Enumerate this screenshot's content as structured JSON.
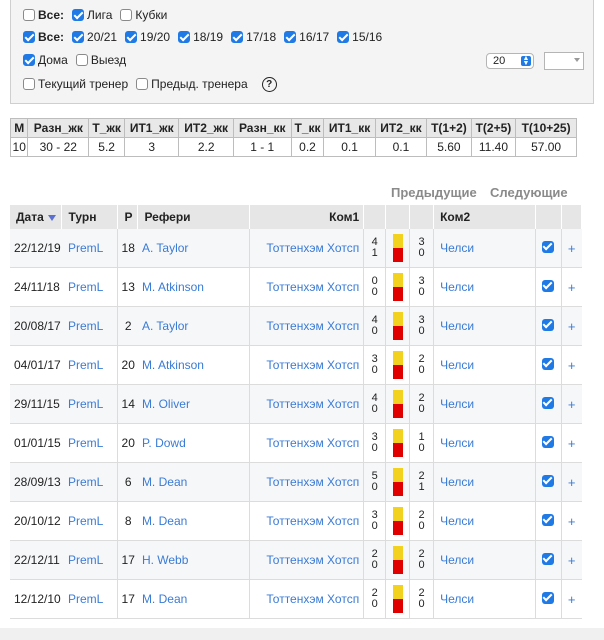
{
  "filters": {
    "row1": [
      {
        "label": "Все:",
        "checked": false,
        "bold": true
      },
      {
        "label": "Лига",
        "checked": true,
        "bold": false
      },
      {
        "label": "Кубки",
        "checked": false,
        "bold": false
      }
    ],
    "row2": [
      {
        "label": "Все:",
        "checked": true,
        "bold": true
      },
      {
        "label": "20/21",
        "checked": true,
        "bold": false
      },
      {
        "label": "19/20",
        "checked": true,
        "bold": false
      },
      {
        "label": "18/19",
        "checked": true,
        "bold": false
      },
      {
        "label": "17/18",
        "checked": true,
        "bold": false
      },
      {
        "label": "16/17",
        "checked": true,
        "bold": false
      },
      {
        "label": "15/16",
        "checked": true,
        "bold": false
      }
    ],
    "row3": [
      {
        "label": "Дома",
        "checked": true,
        "bold": false
      },
      {
        "label": "Выезд",
        "checked": false,
        "bold": false
      }
    ],
    "row4": [
      {
        "label": "Текущий тренер",
        "checked": false,
        "bold": false
      },
      {
        "label": "Предыд. тренера",
        "checked": false,
        "bold": false
      }
    ],
    "help": "?",
    "count_select": "20",
    "spin_value": ""
  },
  "stats": {
    "headers": [
      "М",
      "Разн_жк",
      "Т_жк",
      "ИТ1_жк",
      "ИТ2_жк",
      "Разн_кк",
      "Т_кк",
      "ИТ1_кк",
      "ИТ2_кк",
      "Т(1+2)",
      "Т(2+5)",
      "Т(10+25)"
    ],
    "values": [
      "10",
      "30 - 22",
      "5.2",
      "3",
      "2.2",
      "1 - 1",
      "0.2",
      "0.1",
      "0.1",
      "5.60",
      "11.40",
      "57.00"
    ]
  },
  "nav": {
    "prev": "Предыдущие",
    "next": "Следующие"
  },
  "matches": {
    "headers": {
      "date": "Дата",
      "tour": "Турн",
      "round": "Р",
      "ref": "Рефери",
      "team1": "Ком1",
      "team2": "Ком2"
    },
    "rows": [
      {
        "date": "22/12/19",
        "tour": "PremL",
        "r": "18",
        "ref": "A. Taylor",
        "t1": "Тоттенхэм Хотсп",
        "s1a": "4",
        "s1b": "1",
        "s2a": "3",
        "s2b": "0",
        "t2": "Челси"
      },
      {
        "date": "24/11/18",
        "tour": "PremL",
        "r": "13",
        "ref": "M. Atkinson",
        "t1": "Тоттенхэм Хотсп",
        "s1a": "0",
        "s1b": "0",
        "s2a": "3",
        "s2b": "0",
        "t2": "Челси"
      },
      {
        "date": "20/08/17",
        "tour": "PremL",
        "r": "2",
        "ref": "A. Taylor",
        "t1": "Тоттенхэм Хотсп",
        "s1a": "4",
        "s1b": "0",
        "s2a": "3",
        "s2b": "0",
        "t2": "Челси"
      },
      {
        "date": "04/01/17",
        "tour": "PremL",
        "r": "20",
        "ref": "M. Atkinson",
        "t1": "Тоттенхэм Хотсп",
        "s1a": "3",
        "s1b": "0",
        "s2a": "2",
        "s2b": "0",
        "t2": "Челси"
      },
      {
        "date": "29/11/15",
        "tour": "PremL",
        "r": "14",
        "ref": "M. Oliver",
        "t1": "Тоттенхэм Хотсп",
        "s1a": "4",
        "s1b": "0",
        "s2a": "2",
        "s2b": "0",
        "t2": "Челси"
      },
      {
        "date": "01/01/15",
        "tour": "PremL",
        "r": "20",
        "ref": "P. Dowd",
        "t1": "Тоттенхэм Хотсп",
        "s1a": "3",
        "s1b": "0",
        "s2a": "1",
        "s2b": "0",
        "t2": "Челси"
      },
      {
        "date": "28/09/13",
        "tour": "PremL",
        "r": "6",
        "ref": "M. Dean",
        "t1": "Тоттенхэм Хотсп",
        "s1a": "5",
        "s1b": "0",
        "s2a": "2",
        "s2b": "1",
        "t2": "Челси"
      },
      {
        "date": "20/10/12",
        "tour": "PremL",
        "r": "8",
        "ref": "M. Dean",
        "t1": "Тоттенхэм Хотсп",
        "s1a": "3",
        "s1b": "0",
        "s2a": "2",
        "s2b": "0",
        "t2": "Челси"
      },
      {
        "date": "22/12/11",
        "tour": "PremL",
        "r": "17",
        "ref": "H. Webb",
        "t1": "Тоттенхэм Хотсп",
        "s1a": "2",
        "s1b": "0",
        "s2a": "2",
        "s2b": "0",
        "t2": "Челси"
      },
      {
        "date": "12/12/10",
        "tour": "PremL",
        "r": "17",
        "ref": "M. Dean",
        "t1": "Тоттенхэм Хотсп",
        "s1a": "2",
        "s1b": "0",
        "s2a": "2",
        "s2b": "0",
        "t2": "Челси"
      }
    ],
    "plus": "+"
  }
}
